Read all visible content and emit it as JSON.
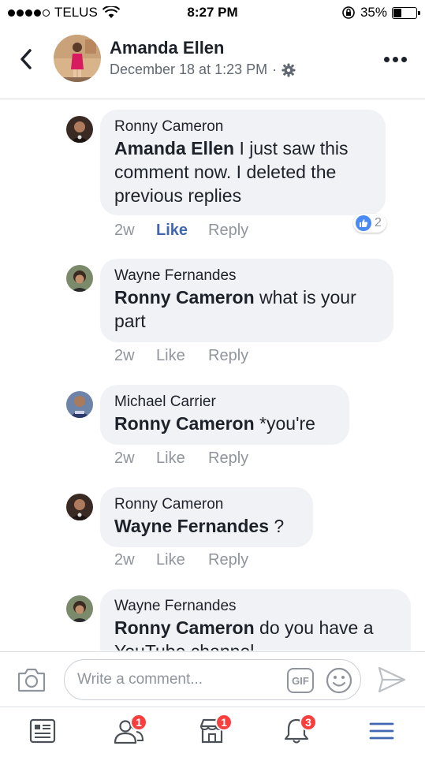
{
  "status_bar": {
    "carrier": "TELUS",
    "time": "8:27 PM",
    "battery_percent": "35%",
    "battery_level": 0.35,
    "icons": [
      "signal-dots-icon",
      "wifi-icon",
      "rotation-lock-icon",
      "battery-icon"
    ]
  },
  "header": {
    "name": "Amanda Ellen",
    "date": "December 18 at 1:23 PM",
    "separator": "·",
    "icons": [
      "back-chevron-icon",
      "gear-icon",
      "more-dots-icon"
    ]
  },
  "comments": [
    {
      "author": "Ronny Cameron",
      "mention": "Amanda Ellen",
      "text": " I just saw this comment now. I deleted the previous replies",
      "time": "2w",
      "like_label": "Like",
      "reply_label": "Reply",
      "liked": true,
      "reaction_count": "2"
    },
    {
      "author": "Wayne Fernandes",
      "mention": "Ronny Cameron",
      "text": " what is your part",
      "time": "2w",
      "like_label": "Like",
      "reply_label": "Reply"
    },
    {
      "author": "Michael Carrier",
      "mention": "Ronny Cameron",
      "text": " *you're",
      "time": "2w",
      "like_label": "Like",
      "reply_label": "Reply"
    },
    {
      "author": "Ronny Cameron",
      "mention": "Wayne Fernandes",
      "text": " ?",
      "time": "2w",
      "like_label": "Like",
      "reply_label": "Reply"
    },
    {
      "author": "Wayne Fernandes",
      "mention": "Ronny Cameron",
      "text": " do you have a YouTube channel"
    }
  ],
  "composer": {
    "placeholder": "Write a comment...",
    "gif_label": "GIF",
    "icons": [
      "camera-icon",
      "gif-icon",
      "emoji-icon",
      "send-icon"
    ]
  },
  "tab_bar": {
    "tabs": [
      {
        "name": "news-feed",
        "badge": ""
      },
      {
        "name": "friend-requests",
        "badge": "1"
      },
      {
        "name": "marketplace",
        "badge": "1"
      },
      {
        "name": "notifications",
        "badge": "3"
      },
      {
        "name": "menu",
        "badge": ""
      }
    ]
  },
  "colors": {
    "accent": "#4267b2",
    "bubble": "#f1f2f6",
    "badge": "#fa3e3e",
    "muted": "#90949c"
  }
}
